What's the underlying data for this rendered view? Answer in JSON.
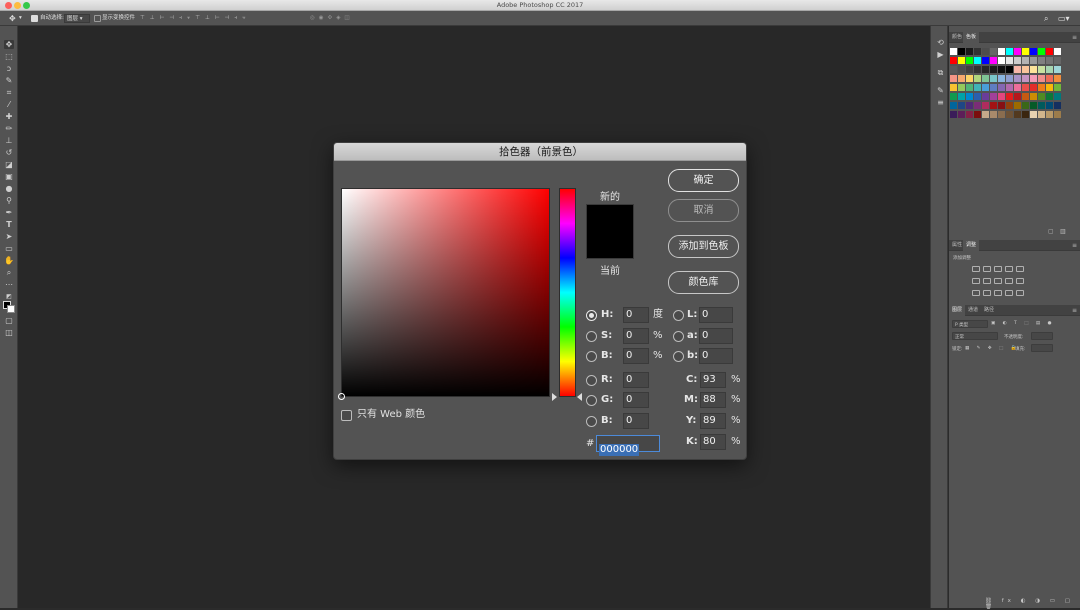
{
  "app": {
    "title": "Adobe Photoshop CC 2017"
  },
  "options_bar": {
    "auto_select_label": "自动选择:",
    "auto_select_value": "图层",
    "show_transform_label": "显示变换控件"
  },
  "right_panels": {
    "swatch_panel": {
      "tabs": [
        "颜色",
        "色板"
      ]
    },
    "adjust_panel": {
      "tabs": [
        "属性",
        "调整"
      ],
      "add_adjustment": "添加调整"
    },
    "layers_panel": {
      "tabs": [
        "图层",
        "通道",
        "路径"
      ],
      "kind": "P 类型",
      "blend_mode": "正常",
      "opacity": "不透明度:",
      "lock": "锁定:",
      "fill": "填充:"
    }
  },
  "colors": {
    "foreground": "#000000",
    "accent": "#4c8ad9",
    "swatches": [
      "#ffffff",
      "#000000",
      "#1a1a1a",
      "#333333",
      "#4d4d4d",
      "#666666",
      "#ffffff",
      "#00ffff",
      "#ff00ff",
      "#ffff00",
      "#0000ff",
      "#00ff00",
      "#ff0000",
      "#ffffff",
      "#ff0000",
      "#ffff00",
      "#00ff00",
      "#00ffff",
      "#0000ff",
      "#ff00ff",
      "#ffffff",
      "#e6e6e6",
      "#cccccc",
      "#b3b3b3",
      "#999999",
      "#808080",
      "#737373",
      "#666666",
      "#595959",
      "#4d4d4d",
      "#404040",
      "#333333",
      "#262626",
      "#1a1a1a",
      "#0d0d0d",
      "#000000",
      "#f8b6a8",
      "#f9c49a",
      "#fde39a",
      "#c8e2a0",
      "#a6d5b0",
      "#9fd6d8",
      "#f69686",
      "#f7a96e",
      "#fcd367",
      "#b0d67e",
      "#7fc595",
      "#79c6c9",
      "#8ab5df",
      "#8e9fd0",
      "#a892c6",
      "#c594c2",
      "#f49ab6",
      "#f08e8c",
      "#ec6b57",
      "#f18d3c",
      "#f9c231",
      "#94c95c",
      "#4fb477",
      "#40b3b7",
      "#4a9fd9",
      "#5f7dc2",
      "#8567b2",
      "#b26aac",
      "#ee6e9a",
      "#ea4f4c",
      "#e32d2a",
      "#ef7d1a",
      "#f7b70a",
      "#70b73a",
      "#109a4f",
      "#00a3a8",
      "#0088cf",
      "#2b5fae",
      "#6a3d9a",
      "#a2409a",
      "#e5467e",
      "#e11d1d",
      "#b5171b",
      "#c65a12",
      "#cc8c04",
      "#4f8b23",
      "#0c7838",
      "#00797c",
      "#00659c",
      "#1f4685",
      "#4f2a77",
      "#7b2c77",
      "#b02c5e",
      "#a31313",
      "#861013",
      "#93400b",
      "#9c6b00",
      "#3a6818",
      "#065a28",
      "#005a5c",
      "#004b74",
      "#142f60",
      "#3a1d59",
      "#5c1e58",
      "#852046",
      "#7b0d0d",
      "#c5a98a",
      "#a88a6b",
      "#8a6d4f",
      "#6d5236",
      "#52391f",
      "#3a2610",
      "#e8d2b0",
      "#d2b68c",
      "#b89968",
      "#9c7c4b"
    ]
  },
  "dialog": {
    "title": "拾色器（前景色）",
    "web_only_label": "只有 Web 颜色",
    "new_label": "新的",
    "current_label": "当前",
    "buttons": {
      "ok": "确定",
      "cancel": "取消",
      "add_swatch": "添加到色板",
      "color_libraries": "颜色库"
    },
    "hsb": [
      {
        "key": "H:",
        "value": "0",
        "unit": "度"
      },
      {
        "key": "S:",
        "value": "0",
        "unit": "%"
      },
      {
        "key": "B:",
        "value": "0",
        "unit": "%"
      }
    ],
    "rgb": [
      {
        "key": "R:",
        "value": "0"
      },
      {
        "key": "G:",
        "value": "0"
      },
      {
        "key": "B:",
        "value": "0"
      }
    ],
    "lab": [
      {
        "key": "L:",
        "value": "0"
      },
      {
        "key": "a:",
        "value": "0"
      },
      {
        "key": "b:",
        "value": "0"
      }
    ],
    "cmyk": [
      {
        "key": "C:",
        "value": "93",
        "unit": "%"
      },
      {
        "key": "M:",
        "value": "88",
        "unit": "%"
      },
      {
        "key": "Y:",
        "value": "89",
        "unit": "%"
      },
      {
        "key": "K:",
        "value": "80",
        "unit": "%"
      }
    ],
    "hex_label": "#",
    "hex_value": "000000"
  }
}
